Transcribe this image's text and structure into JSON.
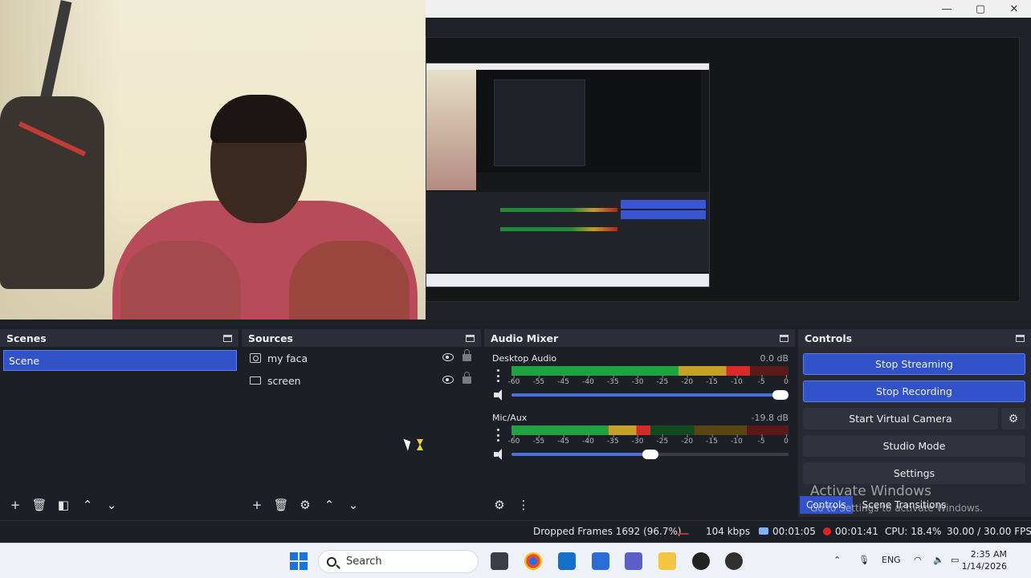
{
  "window": {
    "controls": [
      "—",
      "▢",
      "✕"
    ]
  },
  "scenes": {
    "title": "Scenes",
    "items": [
      {
        "label": "Scene",
        "selected": true
      }
    ]
  },
  "sources": {
    "title": "Sources",
    "items": [
      {
        "label": "my faca",
        "icon": "camera-icon"
      },
      {
        "label": "screen",
        "icon": "monitor-icon"
      }
    ]
  },
  "mixer": {
    "title": "Audio Mixer",
    "channels": [
      {
        "name": "Desktop Audio",
        "db": "0.0 dB",
        "level": 0.86,
        "volume": 1.0
      },
      {
        "name": "Mic/Aux",
        "db": "-19.8 dB",
        "level": 0.5,
        "volume": 0.5
      }
    ],
    "ticks": [
      "-60",
      "-55",
      "-45",
      "-40",
      "-35",
      "-30",
      "-25",
      "-20",
      "-15",
      "-10",
      "-5",
      "0"
    ]
  },
  "controls": {
    "title": "Controls",
    "stop_streaming": "Stop Streaming",
    "stop_recording": "Stop Recording",
    "start_virtual_camera": "Start Virtual Camera",
    "studio_mode": "Studio Mode",
    "settings": "Settings",
    "tab_controls": "Controls",
    "tab_scene_transitions": "Scene Transitions"
  },
  "watermark": {
    "line1": "Activate Windows",
    "line2": "Go to Settings to activate Windows."
  },
  "status": {
    "dropped_frames": "Dropped Frames 1692 (96.7%)",
    "kbps": "104 kbps",
    "stream_time": "00:01:05",
    "rec_time": "00:01:41",
    "cpu": "CPU: 18.4%",
    "fps": "30.00 / 30.00 FPS"
  },
  "taskbar": {
    "search_placeholder": "Search",
    "lang": "ENG",
    "time": "2:35 AM",
    "date": "1/14/2026"
  },
  "colors": {
    "accent": "#3152c8",
    "dock_bg": "#1d1f26",
    "header_bg": "#2b2e38"
  }
}
